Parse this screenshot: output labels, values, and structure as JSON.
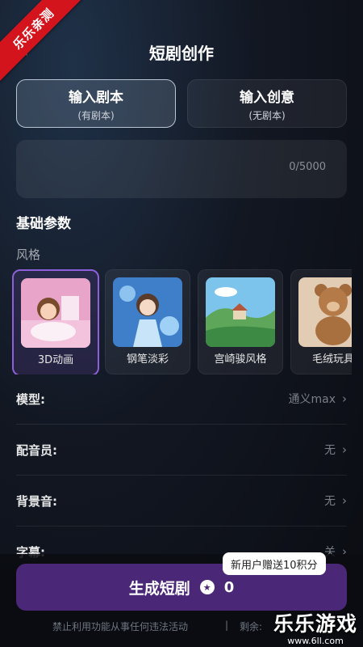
{
  "corner_badge": "乐乐亲测",
  "header": {
    "title": "短剧创作"
  },
  "modes": [
    {
      "label": "输入剧本",
      "sub": "(有剧本)",
      "active": true
    },
    {
      "label": "输入创意",
      "sub": "(无剧本)",
      "active": false
    }
  ],
  "script_input": {
    "counter": "0/5000"
  },
  "basic_params": {
    "title": "基础参数",
    "style_label": "风格"
  },
  "styles": [
    {
      "name": "3D动画",
      "selected": true
    },
    {
      "name": "钢笔淡彩",
      "selected": false
    },
    {
      "name": "宫崎骏风格",
      "selected": false
    },
    {
      "name": "毛绒玩具",
      "selected": false
    }
  ],
  "settings": [
    {
      "label": "模型:",
      "value": "通义max"
    },
    {
      "label": "配音员:",
      "value": "无"
    },
    {
      "label": "背景音:",
      "value": "无"
    },
    {
      "label": "字幕:",
      "value": "关"
    }
  ],
  "generate": {
    "label": "生成短剧",
    "cost": "0",
    "promo": "新用户赠送10积分"
  },
  "footer": {
    "notice": "禁止利用功能从事任何违法活动",
    "separator": "|",
    "remaining": "剩余:"
  },
  "watermark": {
    "main": "乐乐游戏",
    "sub": "www.6ll.com"
  }
}
